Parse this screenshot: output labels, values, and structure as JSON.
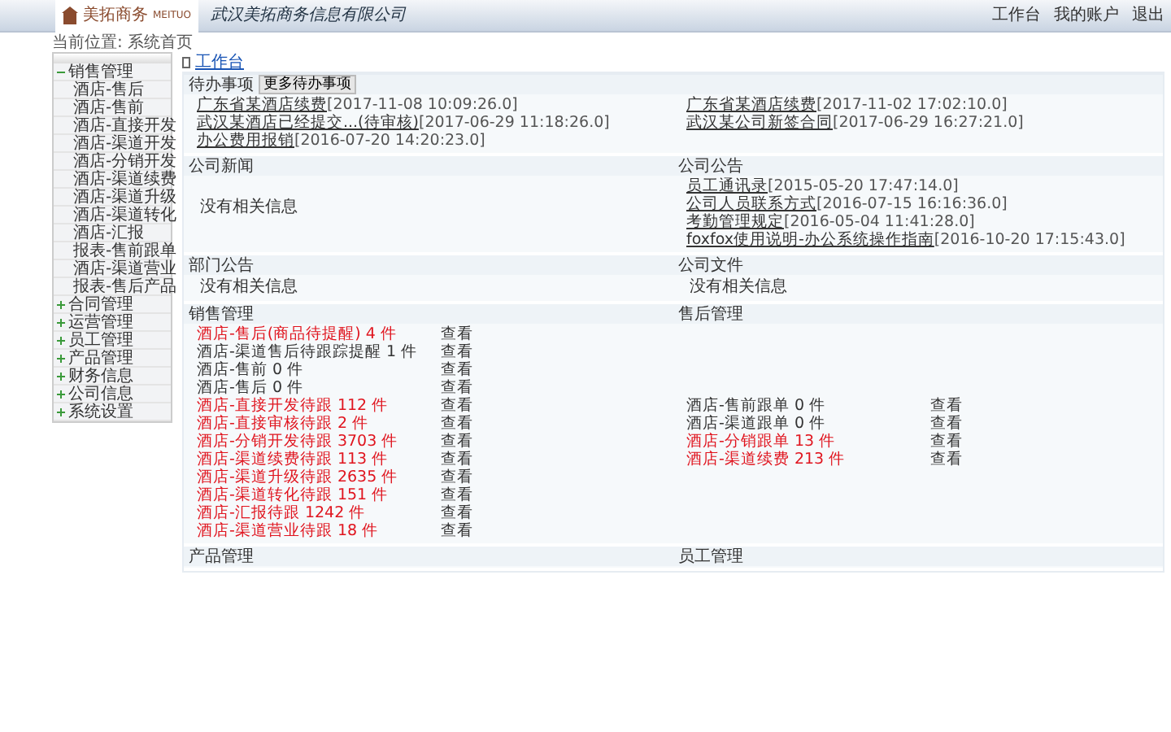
{
  "header": {
    "logo_text": "美拓商务",
    "logo_subtext": "MEITUO",
    "company": "武汉美拓商务信息有限公司",
    "links": [
      "工作台",
      "我的账户",
      "退出"
    ]
  },
  "breadcrumb": "当前位置: 系统首页",
  "sidebar": {
    "items": [
      {
        "label": "销售管理",
        "expanded": true,
        "children": [
          {
            "label": "酒店-售后"
          },
          {
            "label": "酒店-售前"
          },
          {
            "label": "酒店-直接开发"
          },
          {
            "label": "酒店-渠道开发"
          },
          {
            "label": "酒店-分销开发"
          },
          {
            "label": "酒店-渠道续费"
          },
          {
            "label": "酒店-渠道升级"
          },
          {
            "label": "酒店-渠道转化"
          },
          {
            "label": "酒店-汇报"
          },
          {
            "label": "报表-售前跟单"
          },
          {
            "label": "酒店-渠道营业"
          },
          {
            "label": "报表-售后产品"
          }
        ]
      },
      {
        "label": "合同管理",
        "expanded": false
      },
      {
        "label": "运营管理",
        "expanded": false
      },
      {
        "label": "员工管理",
        "expanded": false
      },
      {
        "label": "产品管理",
        "expanded": false
      },
      {
        "label": "财务信息",
        "expanded": false
      },
      {
        "label": "公司信息",
        "expanded": false
      },
      {
        "label": "系统设置",
        "expanded": false
      }
    ]
  },
  "page_title": "工作台",
  "todo": {
    "title": "待办事项",
    "button": "更多待办事项",
    "left": [
      {
        "link": "广东省某酒店续费",
        "date": "[2017-11-08 10:09:26.0]"
      },
      {
        "link": "武汉某酒店已经提交...(待审核)",
        "date": "[2017-06-29 11:18:26.0]"
      },
      {
        "link": "办公费用报销",
        "date": "[2016-07-20 14:20:23.0]"
      }
    ],
    "right": [
      {
        "link": "广东省某酒店续费",
        "date": "[2017-11-02 17:02:10.0]"
      },
      {
        "link": "武汉某公司新签合同",
        "date": "[2017-06-29 16:27:21.0]"
      }
    ]
  },
  "news": {
    "title": "公司新闻",
    "empty": "没有相关信息"
  },
  "notices": {
    "title": "公司公告",
    "items": [
      {
        "link": "员工通讯录",
        "date": "[2015-05-20 17:47:14.0]"
      },
      {
        "link": "公司人员联系方式",
        "date": "[2016-07-15 16:16:36.0]"
      },
      {
        "link": "考勤管理规定",
        "date": "[2016-05-04 11:41:28.0]"
      },
      {
        "link": "foxfox使用说明-办公系统操作指南",
        "date": "[2016-10-20 17:15:43.0]"
      }
    ]
  },
  "dept": {
    "title": "部门公告",
    "empty": "没有相关信息"
  },
  "files": {
    "title": "公司文件",
    "empty": "没有相关信息"
  },
  "sales": {
    "title": "销售管理",
    "right_title": "售后管理",
    "left": [
      {
        "text": "酒店-售后(商品待提醒) 4 件",
        "alert": true,
        "action": "查看"
      },
      {
        "text": "酒店-渠道售后待跟踪提醒 1 件",
        "alert": false,
        "action": "查看"
      },
      {
        "text": "酒店-售前 0 件",
        "alert": false,
        "action": "查看"
      },
      {
        "text": "酒店-售后 0 件",
        "alert": false,
        "action": "查看"
      },
      {
        "text": "酒店-直接开发待跟 112 件",
        "alert": true,
        "action": "查看"
      },
      {
        "text": "酒店-直接审核待跟 2 件",
        "alert": true,
        "action": "查看"
      },
      {
        "text": "酒店-分销开发待跟 3703 件",
        "alert": true,
        "action": "查看"
      },
      {
        "text": "酒店-渠道续费待跟 113 件",
        "alert": true,
        "action": "查看"
      },
      {
        "text": "酒店-渠道升级待跟 2635 件",
        "alert": true,
        "action": "查看"
      },
      {
        "text": "酒店-渠道转化待跟 151 件",
        "alert": true,
        "action": "查看"
      },
      {
        "text": "酒店-汇报待跟 1242 件",
        "alert": true,
        "action": "查看"
      },
      {
        "text": "酒店-渠道营业待跟 18 件",
        "alert": true,
        "action": "查看"
      }
    ],
    "right": [
      {
        "text": "酒店-售前跟单 0 件",
        "alert": false,
        "action": "查看"
      },
      {
        "text": "酒店-渠道跟单 0 件",
        "alert": false,
        "action": "查看"
      },
      {
        "text": "酒店-分销跟单 13 件",
        "alert": true,
        "action": "查看"
      },
      {
        "text": "酒店-渠道续费 213 件",
        "alert": true,
        "action": "查看"
      }
    ]
  },
  "bottom": {
    "left_title": "产品管理",
    "right_title": "员工管理"
  }
}
